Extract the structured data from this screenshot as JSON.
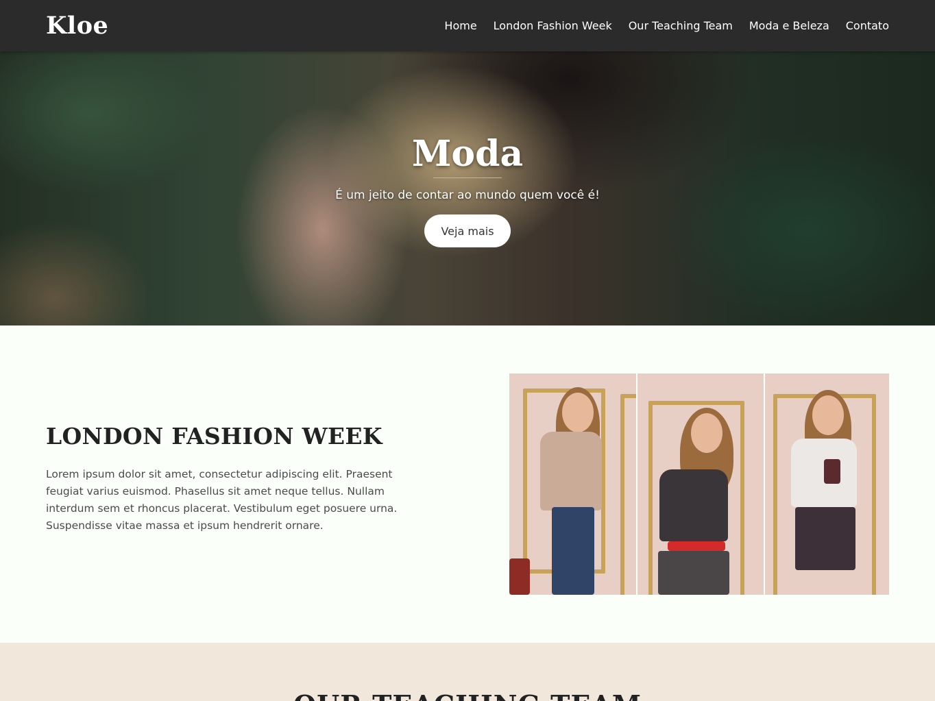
{
  "header": {
    "brand": "Kloe",
    "nav": [
      {
        "label": "Home"
      },
      {
        "label": "London Fashion Week"
      },
      {
        "label": "Our Teaching Team"
      },
      {
        "label": "Moda e Beleza"
      },
      {
        "label": "Contato"
      }
    ]
  },
  "hero": {
    "title": "Moda",
    "subtitle": "É um jeito de contar ao mundo quem você é!",
    "button": "Veja mais"
  },
  "london": {
    "heading": "LONDON FASHION WEEK",
    "text": "Lorem ipsum dolor sit amet, consectetur adipiscing elit. Praesent feugiat varius euismod. Phasellus sit amet neque tellus. Nullam interdum sem et rhoncus placerat. Vestibulum eget posuere urna. Suspendisse vitae massa et ipsum hendrerit ornare."
  },
  "team": {
    "heading": "OUR TEACHING TEAM"
  },
  "colors": {
    "navbar": "#2b2b2b",
    "section_bg": "#fafffa",
    "team_bg": "#f1e7da",
    "accent_gold": "#d8b46a"
  }
}
